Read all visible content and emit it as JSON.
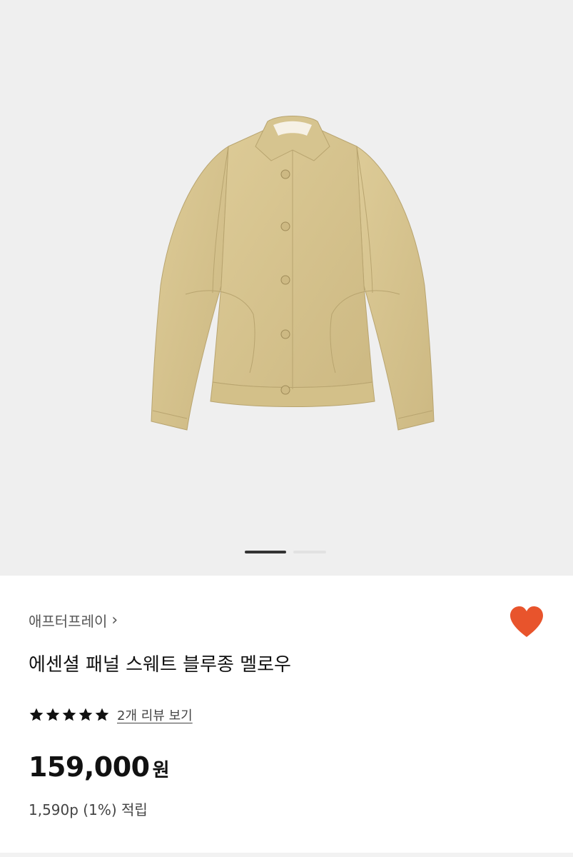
{
  "product": {
    "brand": "애프터프레이",
    "title": "에센셜 패널 스웨트 블루종 멜로우",
    "rating_stars": 5,
    "review_link": "2개 리뷰 보기",
    "price_amount": "159,000",
    "price_unit": "원",
    "points": "1,590p (1%) 적립",
    "wishlisted": true
  },
  "gallery": {
    "current_index": 1,
    "total": 2
  },
  "colors": {
    "heart": "#e8542c",
    "garment": "#d9c792",
    "hero_bg": "#efefef",
    "pager_active": "#333333",
    "pager_inactive": "#e2e2e2"
  },
  "icons": {
    "brand_chevron": "chevron-right-icon",
    "wishlist": "heart-icon",
    "rating": "star-icon"
  }
}
